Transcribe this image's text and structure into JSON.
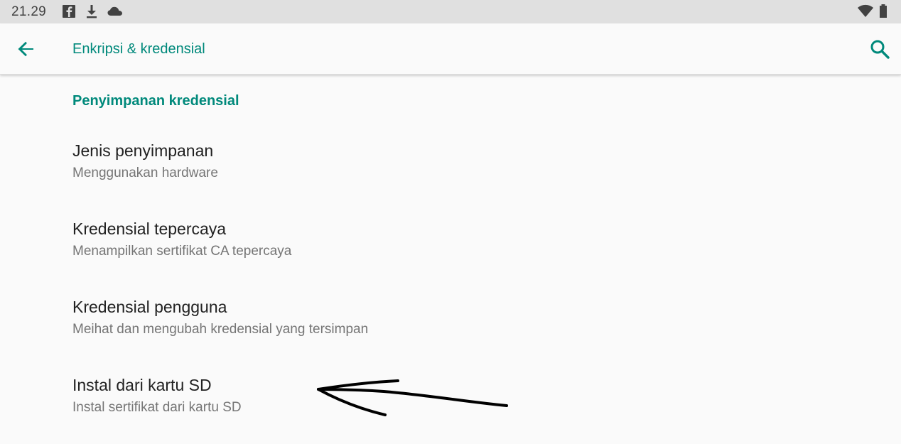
{
  "status_bar": {
    "time": "21.29",
    "icons_left": [
      "facebook-icon",
      "download-icon",
      "cloud-icon"
    ],
    "icons_right": [
      "wifi-icon",
      "battery-icon"
    ]
  },
  "app_bar": {
    "title": "Enkripsi & kredensial",
    "accent_color": "#00897b"
  },
  "section": {
    "header": "Penyimpanan kredensial"
  },
  "items": [
    {
      "title": "Jenis penyimpanan",
      "summary": "Menggunakan hardware"
    },
    {
      "title": "Kredensial tepercaya",
      "summary": "Menampilkan sertifikat CA tepercaya"
    },
    {
      "title": "Kredensial pengguna",
      "summary": "Meihat dan mengubah kredensial yang tersimpan"
    },
    {
      "title": "Instal dari kartu SD",
      "summary": "Instal sertifikat dari kartu SD"
    }
  ],
  "annotation": {
    "type": "hand-drawn arrow",
    "points_to": "Instal dari kartu SD",
    "color": "#000000"
  }
}
